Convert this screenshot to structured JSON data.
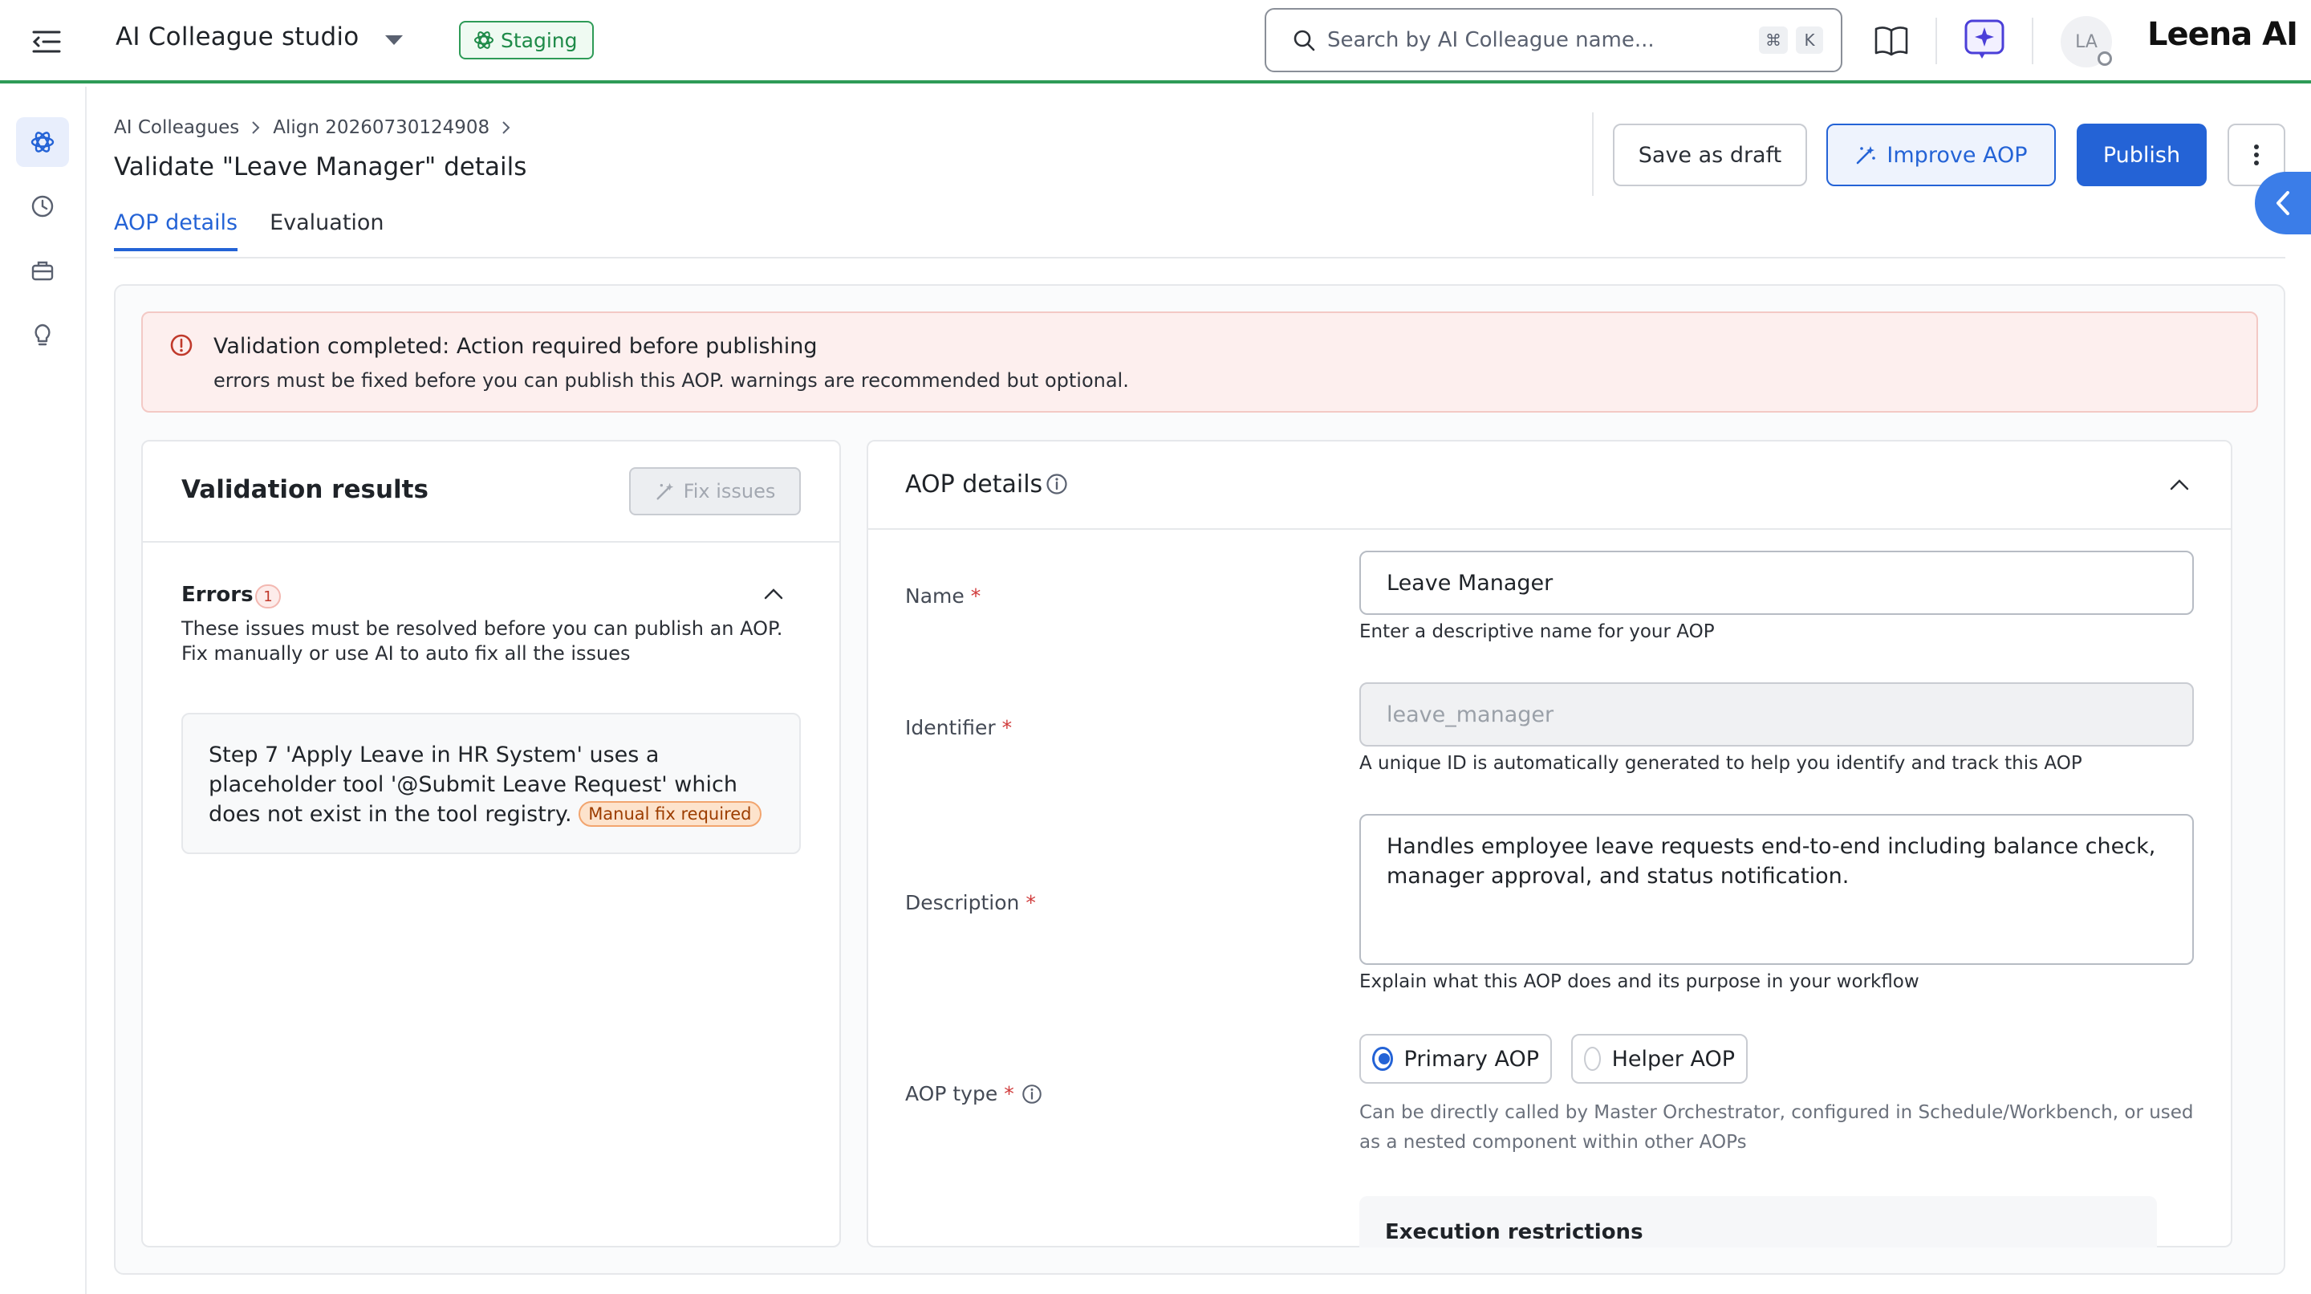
{
  "header": {
    "studio_title": "AI Colleague studio",
    "env_badge": "Staging",
    "search_placeholder": "Search by AI Colleague name...",
    "shortcut_keys": [
      "⌘",
      "K"
    ],
    "avatar_initials": "LA",
    "brand": "Leena AI"
  },
  "breadcrumb": [
    "AI Colleagues",
    "Align 20260730124908"
  ],
  "page_title": "Validate \"Leave Manager\" details",
  "tabs": [
    {
      "label": "AOP details",
      "active": true
    },
    {
      "label": "Evaluation",
      "active": false
    }
  ],
  "actions": {
    "save_draft": "Save as draft",
    "improve": "Improve AOP",
    "publish": "Publish"
  },
  "alert": {
    "title": "Validation completed: Action required before publishing",
    "body": "errors must be fixed before you can publish this AOP. warnings are recommended but optional."
  },
  "validation": {
    "title": "Validation results",
    "fix_button": "Fix issues",
    "errors_label": "Errors",
    "errors_count": "1",
    "errors_desc": "These issues must be resolved before you can publish an AOP. Fix manually or use AI to auto fix all the issues",
    "issues": [
      {
        "text": "Step 7 'Apply Leave in HR System' uses a placeholder tool '@Submit Leave Request' which does not exist in the tool registry.",
        "badge": "Manual fix required"
      }
    ]
  },
  "aop": {
    "title": "AOP details",
    "name_label": "Name",
    "name_value": "Leave Manager",
    "name_helper": "Enter a descriptive name for your AOP",
    "id_label": "Identifier",
    "id_value": "leave_manager",
    "id_helper": "A unique ID is automatically generated to help you identify and track this AOP",
    "desc_label": "Description",
    "desc_value": "Handles employee leave requests end-to-end including balance check, manager approval, and status notification.",
    "desc_helper": "Explain what this AOP does and its purpose in your workflow",
    "type_label": "AOP type",
    "type_options": [
      {
        "label": "Primary AOP",
        "selected": true
      },
      {
        "label": "Helper AOP",
        "selected": false
      }
    ],
    "type_helper": "Can be directly called by Master Orchestrator, configured in Schedule/Workbench, or used as a nested component within other AOPs",
    "exec_title": "Execution restrictions"
  },
  "colors": {
    "accent": "#2463d6",
    "success": "#2e9b57",
    "error": "#d03b3b"
  },
  "icons": [
    "menu-icon",
    "chevron-down-icon",
    "atom-icon",
    "search-icon",
    "book-icon",
    "sparkle-icon",
    "alert-circle-icon",
    "magic-wand-icon",
    "kebab-icon",
    "chevron-left-icon",
    "chevron-up-icon",
    "info-icon",
    "history-icon",
    "briefcase-icon",
    "lightbulb-icon"
  ]
}
